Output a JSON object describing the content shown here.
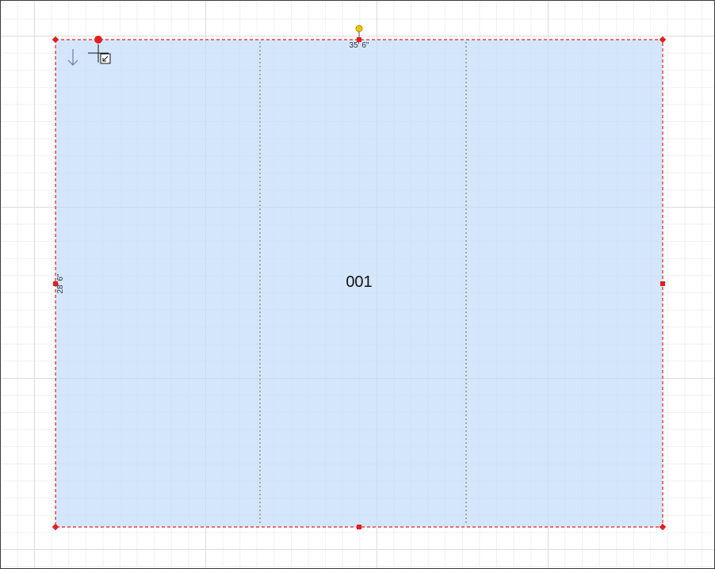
{
  "floor_plan": {
    "room_label": "001",
    "width_dimension": "35' 6\"",
    "height_dimension": "28' 6\""
  },
  "icons": {
    "direction_arrow": "arrow-down-icon",
    "cursor": "crosshair-cursor-icon",
    "resize_hint": "resize-diagonal-icon"
  },
  "colors": {
    "room_fill": "#C4DCFA",
    "selection_outline": "#E81C1C",
    "rotation_handle": "#F2C500",
    "grid_major": "#DCDCDC",
    "grid_minor": "#F0F0F0"
  }
}
